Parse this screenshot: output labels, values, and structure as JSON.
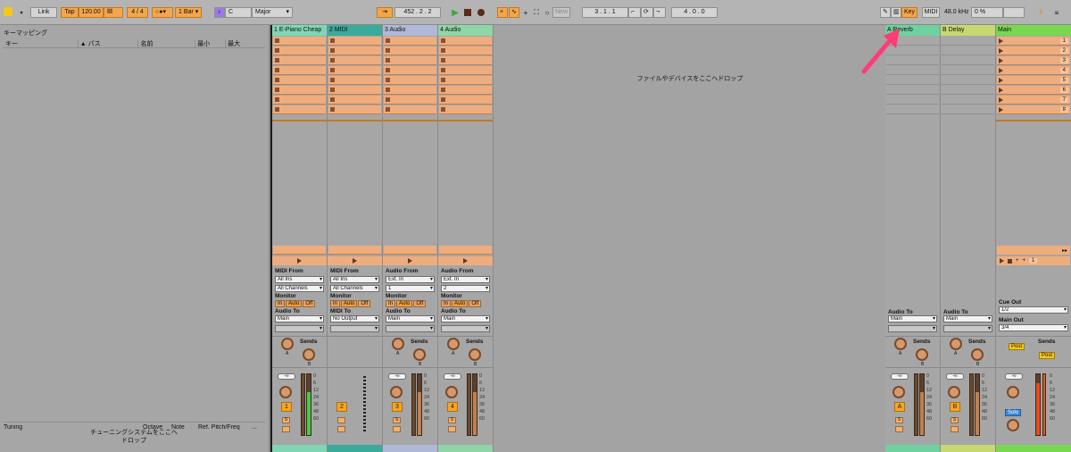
{
  "toolbar": {
    "link": "Link",
    "tap": "Tap",
    "tempo": "120.00",
    "signature": "4 / 4",
    "quantize": "1 Bar",
    "key": "C",
    "scale": "Major",
    "position": "452 .  2 .  2",
    "new": "New",
    "loop_start": "3 .  1 .  1",
    "loop_length": "4 .  0 .  0",
    "key_button": "Key",
    "midi_button": "MIDI",
    "sample_rate": "48.0 kHz",
    "cpu": "0 %"
  },
  "left_panel": {
    "title": "キーマッピング",
    "columns": [
      "キー",
      "パス",
      "名前",
      "最小",
      "最大"
    ],
    "tuning_columns": [
      "Tuning",
      "Octave",
      "Note",
      "Ref. Pitch/Freq",
      "..."
    ],
    "tuning_drop": "チューニングシステムをここへドロップ"
  },
  "session": {
    "drop_message": "ファイルやデバイスをここへドロップ",
    "tracks": [
      {
        "name": "1 E-Piano Cheap",
        "type": "midi",
        "color": "#7fd6b4",
        "from_label": "MIDI From",
        "from": "All Ins",
        "channel": "All Channels",
        "monitor_label": "Monitor",
        "monitor": [
          "In",
          "Auto",
          "Off"
        ],
        "to_label": "Audio To",
        "to": "Main",
        "sends_label": "Sends",
        "num": "1",
        "inf": "-∞",
        "solo": "S"
      },
      {
        "name": "2 MIDI",
        "type": "midi",
        "color": "#3aaa9a",
        "from_label": "MIDI From",
        "from": "All Ins",
        "channel": "All Channels",
        "monitor_label": "Monitor",
        "monitor": [
          "In",
          "Auto",
          "Off"
        ],
        "to_label": "MIDI To",
        "to": "No Output",
        "num": "2"
      },
      {
        "name": "3 Audio",
        "type": "audio",
        "color": "#b0b8d8",
        "from_label": "Audio From",
        "from": "Ext. In",
        "channel": "1",
        "monitor_label": "Monitor",
        "monitor": [
          "In",
          "Auto",
          "Off"
        ],
        "to_label": "Audio To",
        "to": "Main",
        "sends_label": "Sends",
        "num": "3",
        "inf": "-∞",
        "solo": "S"
      },
      {
        "name": "4 Audio",
        "type": "audio",
        "color": "#8ed6a6",
        "from_label": "Audio From",
        "from": "Ext. In",
        "channel": "2",
        "monitor_label": "Monitor",
        "monitor": [
          "In",
          "Auto",
          "Off"
        ],
        "to_label": "Audio To",
        "to": "Main",
        "sends_label": "Sends",
        "num": "4",
        "inf": "-∞",
        "solo": "S"
      }
    ],
    "returns": [
      {
        "name": "A Reverb",
        "color": "#6fd0a0",
        "to_label": "Audio To",
        "to": "Main",
        "sends_label": "Sends",
        "num": "A",
        "inf": "-∞",
        "solo": "S"
      },
      {
        "name": "B Delay",
        "color": "#c8d870",
        "to_label": "Audio To",
        "to": "Main",
        "sends_label": "Sends",
        "num": "B",
        "inf": "-∞",
        "solo": "S"
      }
    ],
    "main": {
      "name": "Main",
      "color": "#78d850",
      "cue_label": "Cue Out",
      "cue": "1/2",
      "main_out_label": "Main Out",
      "main_out": "3/4",
      "sends_label": "Sends",
      "post": "Post",
      "inf": "-∞",
      "solo": "Solo",
      "scenes": [
        "1",
        "2",
        "3",
        "4",
        "5",
        "6",
        "7",
        "8"
      ],
      "scene_num": "1"
    },
    "scale_marks": [
      "0",
      "6",
      "12",
      "24",
      "36",
      "48",
      "60"
    ],
    "knob_a": "A",
    "knob_b": "B"
  },
  "colors": {
    "accent": "#f3a64b",
    "clip": "#efad7e",
    "arrow": "#ff3b78"
  }
}
